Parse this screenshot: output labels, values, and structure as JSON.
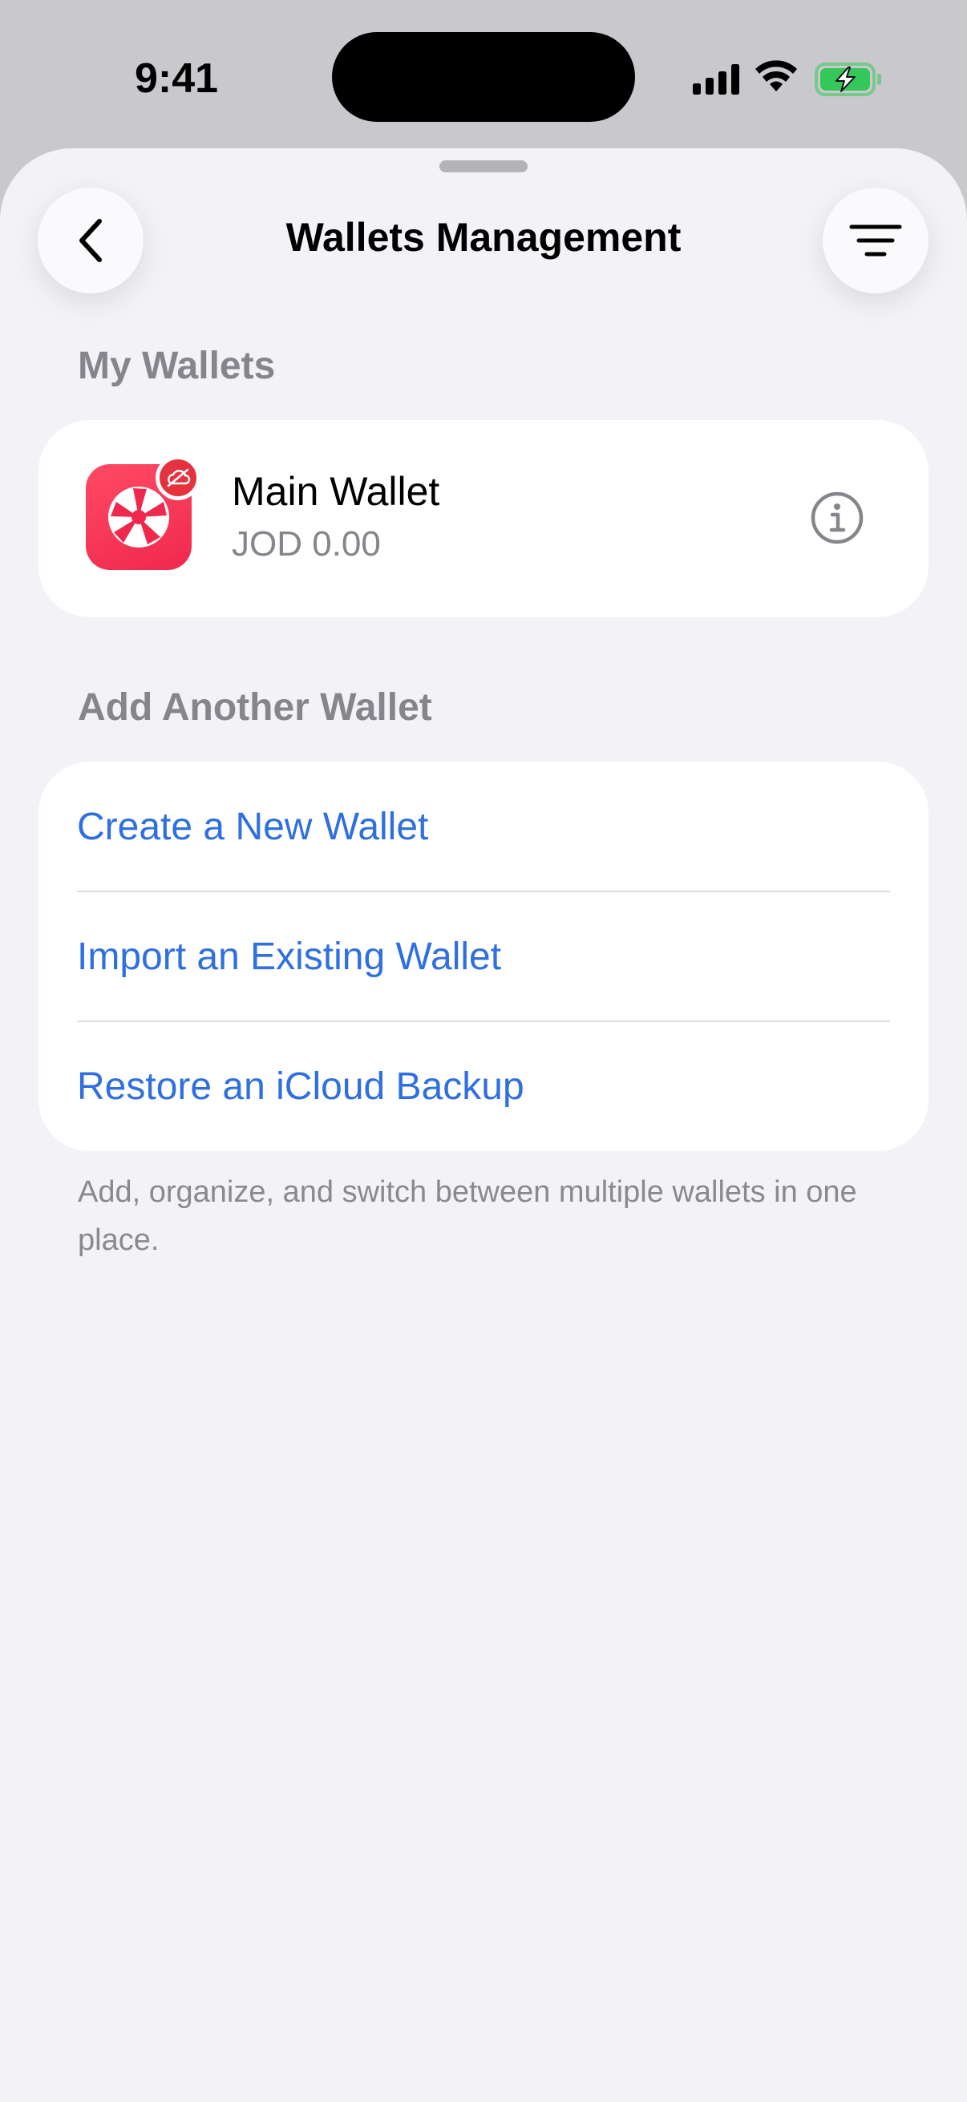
{
  "status_bar": {
    "time": "9:41"
  },
  "nav": {
    "title": "Wallets Management",
    "back_icon": "chevron-left-icon",
    "filter_icon": "filter-lines-icon"
  },
  "my_wallets": {
    "header": "My Wallets",
    "wallet": {
      "name": "Main Wallet",
      "balance": "JOD 0.00",
      "icon": "aperture-logo-icon",
      "badge_icon": "cloud-off-icon",
      "info_icon": "info-circle-icon"
    }
  },
  "add_wallet": {
    "header": "Add Another Wallet",
    "actions": [
      {
        "label": "Create a New Wallet"
      },
      {
        "label": "Import an Existing Wallet"
      },
      {
        "label": "Restore an iCloud Backup"
      }
    ],
    "footer": "Add, organize, and switch between multiple wallets in one place."
  },
  "colors": {
    "accent": "#2f6fe0",
    "background": "#f2f2f7",
    "secondary_text": "#86858b",
    "brand": "#f0284e",
    "battery_charging": "#34c759"
  }
}
